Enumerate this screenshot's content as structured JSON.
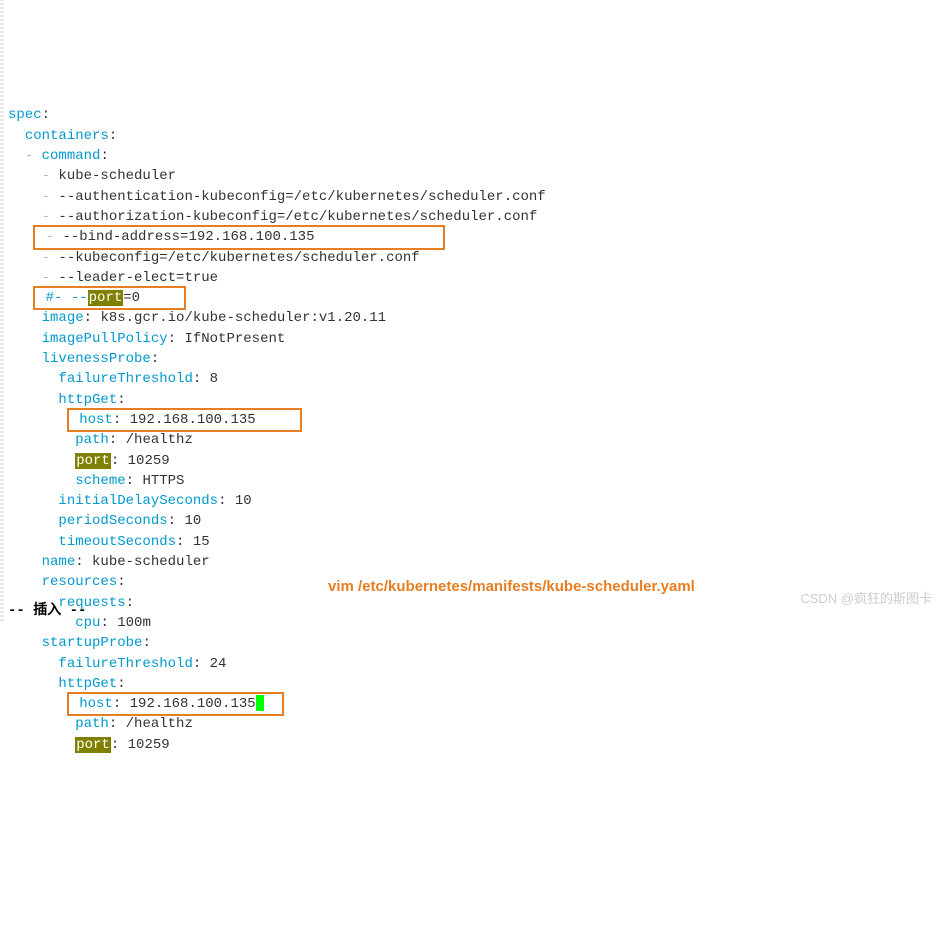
{
  "yaml": {
    "spec": "spec",
    "containers": "containers",
    "command": "command",
    "args": [
      "kube-scheduler",
      "--authentication-kubeconfig=/etc/kubernetes/scheduler.conf",
      "--authorization-kubeconfig=/etc/kubernetes/scheduler.conf",
      "--bind-address=192.168.100.135",
      "--kubeconfig=/etc/kubernetes/scheduler.conf",
      "--leader-elect=true"
    ],
    "commented_line_prefix": "#- --",
    "commented_line_suffix": "=0",
    "port_word": "port",
    "image_key": "image",
    "image_val": "k8s.gcr.io/kube-scheduler:v1.20.11",
    "imagePullPolicy_key": "imagePullPolicy",
    "imagePullPolicy_val": "IfNotPresent",
    "livenessProbe": "livenessProbe",
    "failureThreshold": "failureThreshold",
    "live_ft_val": "8",
    "httpGet": "httpGet",
    "host": "host",
    "live_host_val": "192.168.100.135",
    "path": "path",
    "live_path_val": "/healthz",
    "port_key": "port",
    "live_port_val": "10259",
    "scheme": "scheme",
    "live_scheme_val": "HTTPS",
    "initialDelaySeconds": "initialDelaySeconds",
    "ids_val": "10",
    "periodSeconds": "periodSeconds",
    "ps_val": "10",
    "timeoutSeconds": "timeoutSeconds",
    "ts_val": "15",
    "name_key": "name",
    "name_val": "kube-scheduler",
    "resources": "resources",
    "requests": "requests",
    "cpu": "cpu",
    "cpu_val": "100m",
    "startupProbe": "startupProbe",
    "startup_ft_val": "24",
    "startup_host_val": "192.168.100.135",
    "startup_path_val": "/healthz",
    "startup_port_val": "10259"
  },
  "annotation": "vim /etc/kubernetes/manifests/kube-scheduler.yaml",
  "watermark": "CSDN @疯狂的斯图卡",
  "status": "-- 插入 --"
}
